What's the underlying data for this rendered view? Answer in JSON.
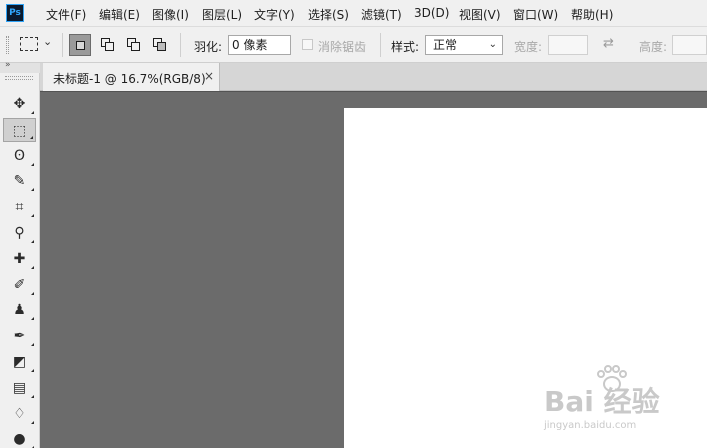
{
  "app": {
    "logo_text": "Ps"
  },
  "menu": {
    "items": [
      "文件(F)",
      "编辑(E)",
      "图像(I)",
      "图层(L)",
      "文字(Y)",
      "选择(S)",
      "滤镜(T)",
      "3D(D)",
      "视图(V)",
      "窗口(W)",
      "帮助(H)"
    ]
  },
  "options": {
    "feather_label": "羽化:",
    "feather_value": "0 像素",
    "antialias_label": "消除锯齿",
    "style_label": "样式:",
    "style_value": "正常",
    "width_label": "宽度:",
    "height_label": "高度:"
  },
  "toolbar": {
    "collapse_glyph": "»",
    "tools": [
      {
        "name": "move-tool-icon",
        "glyph": "✥",
        "active": false
      },
      {
        "name": "marquee-tool-icon",
        "glyph": "⬚",
        "active": true
      },
      {
        "name": "lasso-tool-icon",
        "glyph": "ʘ",
        "active": false
      },
      {
        "name": "quick-selection-tool-icon",
        "glyph": "✎",
        "active": false
      },
      {
        "name": "crop-tool-icon",
        "glyph": "⌗",
        "active": false
      },
      {
        "name": "eyedropper-tool-icon",
        "glyph": "⚲",
        "active": false
      },
      {
        "name": "healing-brush-tool-icon",
        "glyph": "✚",
        "active": false
      },
      {
        "name": "brush-tool-icon",
        "glyph": "✐",
        "active": false
      },
      {
        "name": "clone-stamp-tool-icon",
        "glyph": "♟",
        "active": false
      },
      {
        "name": "history-brush-tool-icon",
        "glyph": "✒",
        "active": false
      },
      {
        "name": "eraser-tool-icon",
        "glyph": "◩",
        "active": false
      },
      {
        "name": "gradient-tool-icon",
        "glyph": "▤",
        "active": false
      },
      {
        "name": "blur-tool-icon",
        "glyph": "♢",
        "active": false
      },
      {
        "name": "dodge-tool-icon",
        "glyph": "●",
        "active": false
      }
    ]
  },
  "document": {
    "tab_title": "未标题-1 @ 16.7%(RGB/8)",
    "close_glyph": "×"
  },
  "watermark": {
    "text": "Bai 经验",
    "sub": "jingyan.baidu.com"
  }
}
